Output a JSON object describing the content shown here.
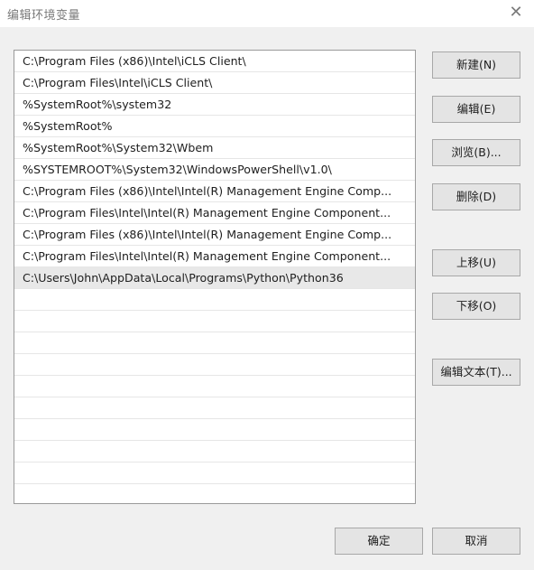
{
  "window": {
    "title": "编辑环境变量",
    "close_glyph": "✕"
  },
  "paths": [
    "C:\\Program Files (x86)\\Intel\\iCLS Client\\",
    "C:\\Program Files\\Intel\\iCLS Client\\",
    "%SystemRoot%\\system32",
    "%SystemRoot%",
    "%SystemRoot%\\System32\\Wbem",
    "%SYSTEMROOT%\\System32\\WindowsPowerShell\\v1.0\\",
    "C:\\Program Files (x86)\\Intel\\Intel(R) Management Engine Comp...",
    "C:\\Program Files\\Intel\\Intel(R) Management Engine Component...",
    "C:\\Program Files (x86)\\Intel\\Intel(R) Management Engine Comp...",
    "C:\\Program Files\\Intel\\Intel(R) Management Engine Component...",
    "C:\\Users\\John\\AppData\\Local\\Programs\\Python\\Python36"
  ],
  "selected_index": 10,
  "buttons": {
    "new": "新建(N)",
    "edit": "编辑(E)",
    "browse": "浏览(B)...",
    "delete": "删除(D)",
    "move_up": "上移(U)",
    "move_down": "下移(O)",
    "edit_text": "编辑文本(T)...",
    "ok": "确定",
    "cancel": "取消"
  }
}
